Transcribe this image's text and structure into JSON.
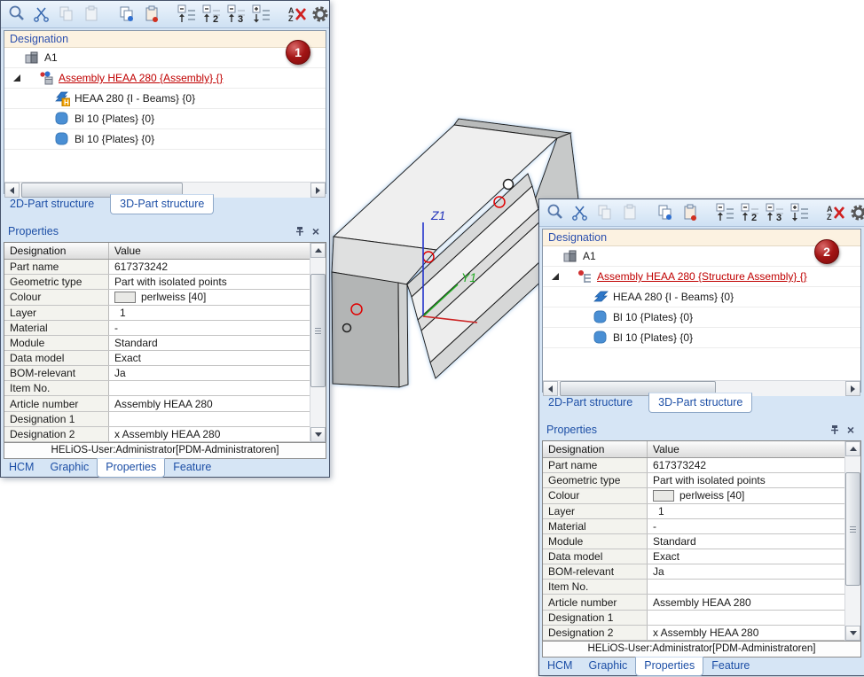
{
  "colors": {
    "accent_blue": "#1d4fa6",
    "assembly_red": "#c00000",
    "badge_red": "#a31515",
    "panel_background": "#d6e5f5",
    "tree_header_cream": "#fcf2e1",
    "beam_grey": "#efefef",
    "axis_z_blue": "#2233cc",
    "axis_y_green": "#22aa22",
    "axis_x_red": "#cc2222"
  },
  "toolbar": {
    "icons": [
      "magnifier",
      "scissors-cut",
      "copy",
      "paste",
      "copy-special",
      "paste-special",
      "collapse-all",
      "collapse-level-2",
      "collapse-level-3",
      "expand-all",
      "clear-sort",
      "settings-gear"
    ],
    "collapse_level2_digit": "2",
    "collapse_level3_digit": "3",
    "sort_letter_a": "A",
    "sort_letter_z": "Z"
  },
  "tree": {
    "header": "Designation"
  },
  "panel1": {
    "badge": "1",
    "tree": {
      "items": [
        {
          "label": "A1",
          "icon": "parts-stack"
        },
        {
          "label": "Assembly HEAA 280 {Assembly} {}",
          "icon": "assembly-spheres",
          "style": "red-underline",
          "expanded": true
        },
        {
          "label": "HEAA 280 {I - Beams} {0}",
          "icon": "i-beam-h-badge"
        },
        {
          "label": "Bl 10 {Plates} {0}",
          "icon": "plate"
        },
        {
          "label": "Bl 10 {Plates} {0}",
          "icon": "plate"
        }
      ]
    }
  },
  "panel2": {
    "badge": "2",
    "tree": {
      "items": [
        {
          "label": "A1",
          "icon": "parts-stack"
        },
        {
          "label": "Assembly HEAA 280 {Structure Assembly} {}",
          "icon": "assembly-structure",
          "style": "red-underline",
          "expanded": true
        },
        {
          "label": "HEAA 280 {I - Beams} {0}",
          "icon": "i-beam"
        },
        {
          "label": "Bl 10 {Plates} {0}",
          "icon": "plate"
        },
        {
          "label": "Bl 10 {Plates} {0}",
          "icon": "plate"
        }
      ]
    }
  },
  "structure_tabs": {
    "tab_2d": "2D-Part structure",
    "tab_3d": "3D-Part structure",
    "active": "3D-Part structure"
  },
  "properties": {
    "title": "Properties",
    "columns": {
      "designation": "Designation",
      "value": "Value"
    },
    "rows": [
      {
        "label": "Part name",
        "value": "617373242"
      },
      {
        "label": "Geometric type",
        "value": "Part with isolated points"
      },
      {
        "label": "Colour",
        "value": "perlweiss [40]",
        "swatch": true
      },
      {
        "label": "Layer",
        "value": "1"
      },
      {
        "label": "Material",
        "value": "-"
      },
      {
        "label": "Module",
        "value": "Standard"
      },
      {
        "label": "Data model",
        "value": "Exact"
      },
      {
        "label": "BOM-relevant",
        "value": "Ja"
      },
      {
        "label": "Item No.",
        "value": ""
      },
      {
        "label": "Article number",
        "value": "Assembly HEAA 280"
      },
      {
        "label": "Designation 1",
        "value": ""
      },
      {
        "label": "Designation 2",
        "value": "x Assembly HEAA 280"
      }
    ],
    "status": "HELiOS-User:Administrator[PDM-Administratoren]"
  },
  "bottom_tabs": {
    "hcm": "HCM",
    "graphic": "Graphic",
    "properties": "Properties",
    "feature": "Feature",
    "active": "Properties"
  },
  "viewport": {
    "z_axis_label": "Z1",
    "y_axis_label": "Y1"
  }
}
